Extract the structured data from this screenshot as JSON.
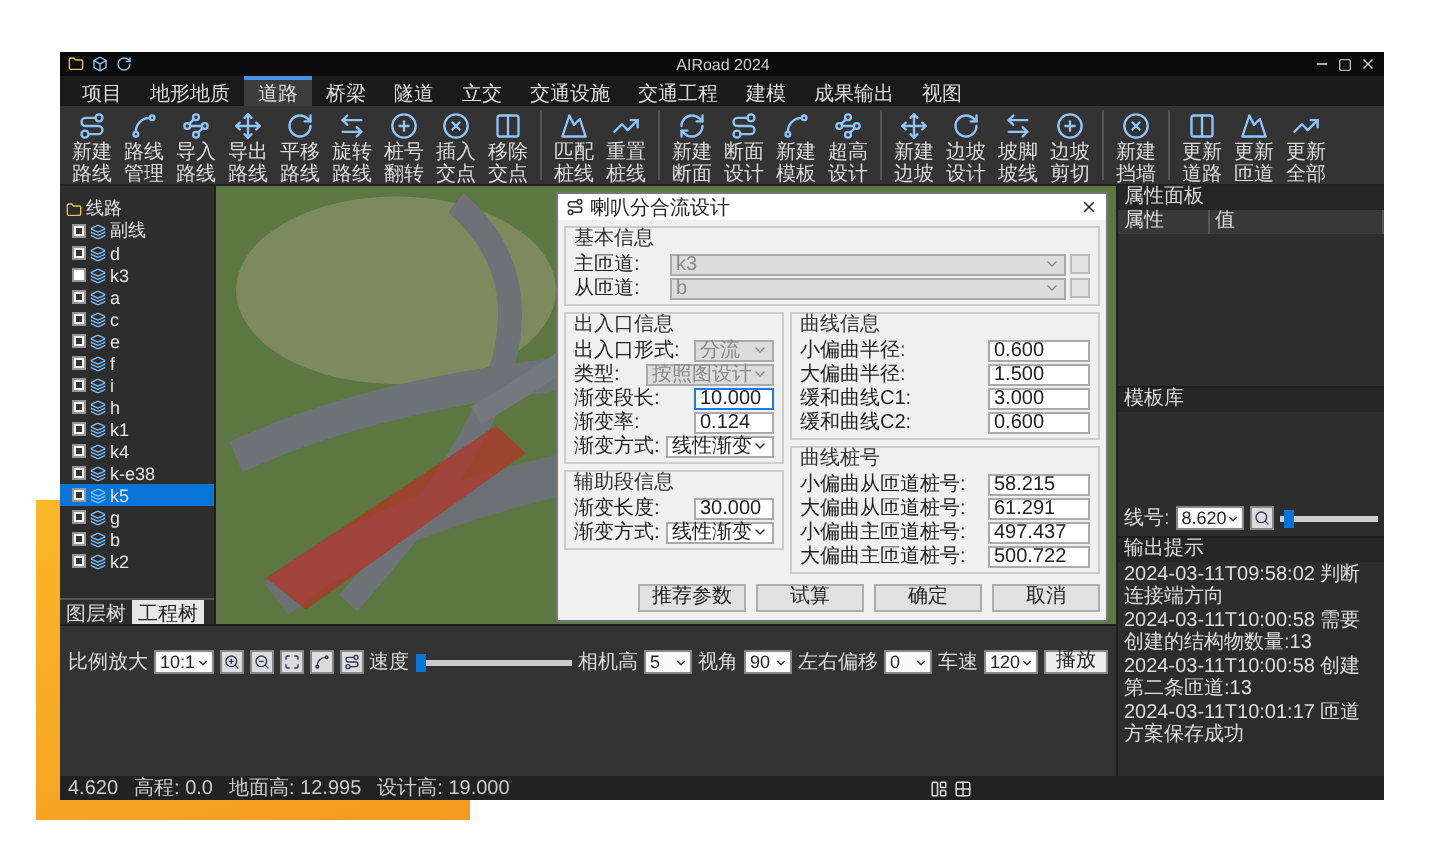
{
  "window": {
    "title": "AIRoad 2024"
  },
  "menu": [
    {
      "label": "项目",
      "selected": false
    },
    {
      "label": "地形地质",
      "selected": false
    },
    {
      "label": "道路",
      "selected": true
    },
    {
      "label": "桥梁",
      "selected": false
    },
    {
      "label": "隧道",
      "selected": false
    },
    {
      "label": "立交",
      "selected": false
    },
    {
      "label": "交通设施",
      "selected": false
    },
    {
      "label": "交通工程",
      "selected": false
    },
    {
      "label": "建模",
      "selected": false
    },
    {
      "label": "成果输出",
      "selected": false
    },
    {
      "label": "视图",
      "selected": false
    }
  ],
  "toolbar_groups": [
    [
      "新建路线",
      "路线管理",
      "导入路线",
      "导出路线",
      "平移路线",
      "旋转路线",
      "桩号翻转",
      "插入交点",
      "移除交点"
    ],
    [
      "匹配桩线",
      "重置桩线"
    ],
    [
      "新建断面",
      "断面设计",
      "新建模板",
      "超高设计"
    ],
    [
      "新建边坡",
      "边坡设计",
      "坡脚坡线",
      "边坡剪切"
    ],
    [
      "新建挡墙"
    ],
    [
      "更新道路",
      "更新匝道",
      "更新全部"
    ]
  ],
  "tree": {
    "label": "线路",
    "children": [
      {
        "label": "副线",
        "checked": true,
        "selected": false
      },
      {
        "label": "d",
        "checked": true,
        "selected": false
      },
      {
        "label": "k3",
        "checked": false,
        "selected": false
      },
      {
        "label": "a",
        "checked": true,
        "selected": false
      },
      {
        "label": "c",
        "checked": true,
        "selected": false
      },
      {
        "label": "e",
        "checked": true,
        "selected": false
      },
      {
        "label": "f",
        "checked": true,
        "selected": false
      },
      {
        "label": "i",
        "checked": true,
        "selected": false
      },
      {
        "label": "h",
        "checked": true,
        "selected": false
      },
      {
        "label": "k1",
        "checked": true,
        "selected": false
      },
      {
        "label": "k4",
        "checked": true,
        "selected": false
      },
      {
        "label": "k-e38",
        "checked": true,
        "selected": false
      },
      {
        "label": "k5",
        "checked": true,
        "selected": true
      },
      {
        "label": "g",
        "checked": true,
        "selected": false
      },
      {
        "label": "b",
        "checked": true,
        "selected": false
      },
      {
        "label": "k2",
        "checked": true,
        "selected": false
      }
    ]
  },
  "bottom_tabs": [
    {
      "label": "图层树",
      "selected": false
    },
    {
      "label": "工程树",
      "selected": true
    }
  ],
  "dialog": {
    "title": "喇叭分合流设计",
    "basic": {
      "title": "基本信息",
      "fields": [
        {
          "label": "主匝道:",
          "value": "k3",
          "kind": "select",
          "disabled": true,
          "focused": false
        },
        {
          "label": "从匝道:",
          "value": "b",
          "kind": "select",
          "disabled": true,
          "focused": false
        }
      ]
    },
    "left": [
      {
        "title": "出入口信息",
        "fields": [
          {
            "label": "出入口形式:",
            "value": "分流",
            "kind": "select",
            "disabled": true,
            "focused": false
          },
          {
            "label": "类型:",
            "value": "按照图设计",
            "kind": "select",
            "disabled": true,
            "focused": false
          },
          {
            "label": "渐变段长:",
            "value": "10.000",
            "kind": "input",
            "disabled": false,
            "focused": true
          },
          {
            "label": "渐变率:",
            "value": "0.124",
            "kind": "input",
            "disabled": false,
            "focused": false
          },
          {
            "label": "渐变方式:",
            "value": "线性渐变",
            "kind": "select",
            "disabled": false,
            "focused": false
          }
        ]
      },
      {
        "title": "辅助段信息",
        "fields": [
          {
            "label": "渐变长度:",
            "value": "30.000",
            "kind": "input",
            "disabled": false,
            "focused": false
          },
          {
            "label": "渐变方式:",
            "value": "线性渐变",
            "kind": "select",
            "disabled": false,
            "focused": false
          }
        ]
      }
    ],
    "right": [
      {
        "title": "曲线信息",
        "fields": [
          {
            "label": "小偏曲半径:",
            "value": "0.600",
            "kind": "input",
            "disabled": false,
            "focused": false
          },
          {
            "label": "大偏曲半径:",
            "value": "1.500",
            "kind": "input",
            "disabled": false,
            "focused": false
          },
          {
            "label": "缓和曲线C1:",
            "value": "3.000",
            "kind": "input",
            "disabled": false,
            "focused": false
          },
          {
            "label": "缓和曲线C2:",
            "value": "0.600",
            "kind": "input",
            "disabled": false,
            "focused": false
          }
        ]
      },
      {
        "title": "曲线桩号",
        "fields": [
          {
            "label": "小偏曲从匝道桩号:",
            "value": "58.215",
            "kind": "input",
            "disabled": false,
            "focused": false
          },
          {
            "label": "大偏曲从匝道桩号:",
            "value": "61.291",
            "kind": "input",
            "disabled": false,
            "focused": false
          },
          {
            "label": "小偏曲主匝道桩号:",
            "value": "497.437",
            "kind": "input",
            "disabled": false,
            "focused": false
          },
          {
            "label": "大偏曲主匝道桩号:",
            "value": "500.722",
            "kind": "input",
            "disabled": false,
            "focused": false
          }
        ]
      }
    ],
    "buttons": [
      "推荐参数",
      "试算",
      "确定",
      "取消"
    ]
  },
  "playback": {
    "zoom_label": "比例放大",
    "zoom": "10:1",
    "speed": {
      "label": "速度",
      "level": 0.0
    },
    "selects": [
      {
        "label": "相机高",
        "value": "5"
      },
      {
        "label": "视角",
        "value": "90"
      },
      {
        "label": "左右偏移",
        "value": "0"
      },
      {
        "label": "车速",
        "value": "120"
      }
    ],
    "play_button": "播放"
  },
  "properties": {
    "title": "属性面板",
    "columns": [
      "属性",
      "值"
    ]
  },
  "template_library": {
    "title": "模板库"
  },
  "line_control": {
    "label": "线号:",
    "value": "8.620",
    "level": 0.04
  },
  "output": {
    "title": "输出提示",
    "lines": [
      "2024-03-11T09:58:02 判断连接端方向",
      "2024-03-11T10:00:58 需要创建的结构物数量:13",
      "2024-03-11T10:00:58 创建第二条匝道:13",
      "2024-03-11T10:01:17 匝道方案保存成功"
    ]
  },
  "status_bar": [
    "4.620",
    "高程: 0.0",
    "地面高: 12.995",
    "设计高: 19.000"
  ]
}
